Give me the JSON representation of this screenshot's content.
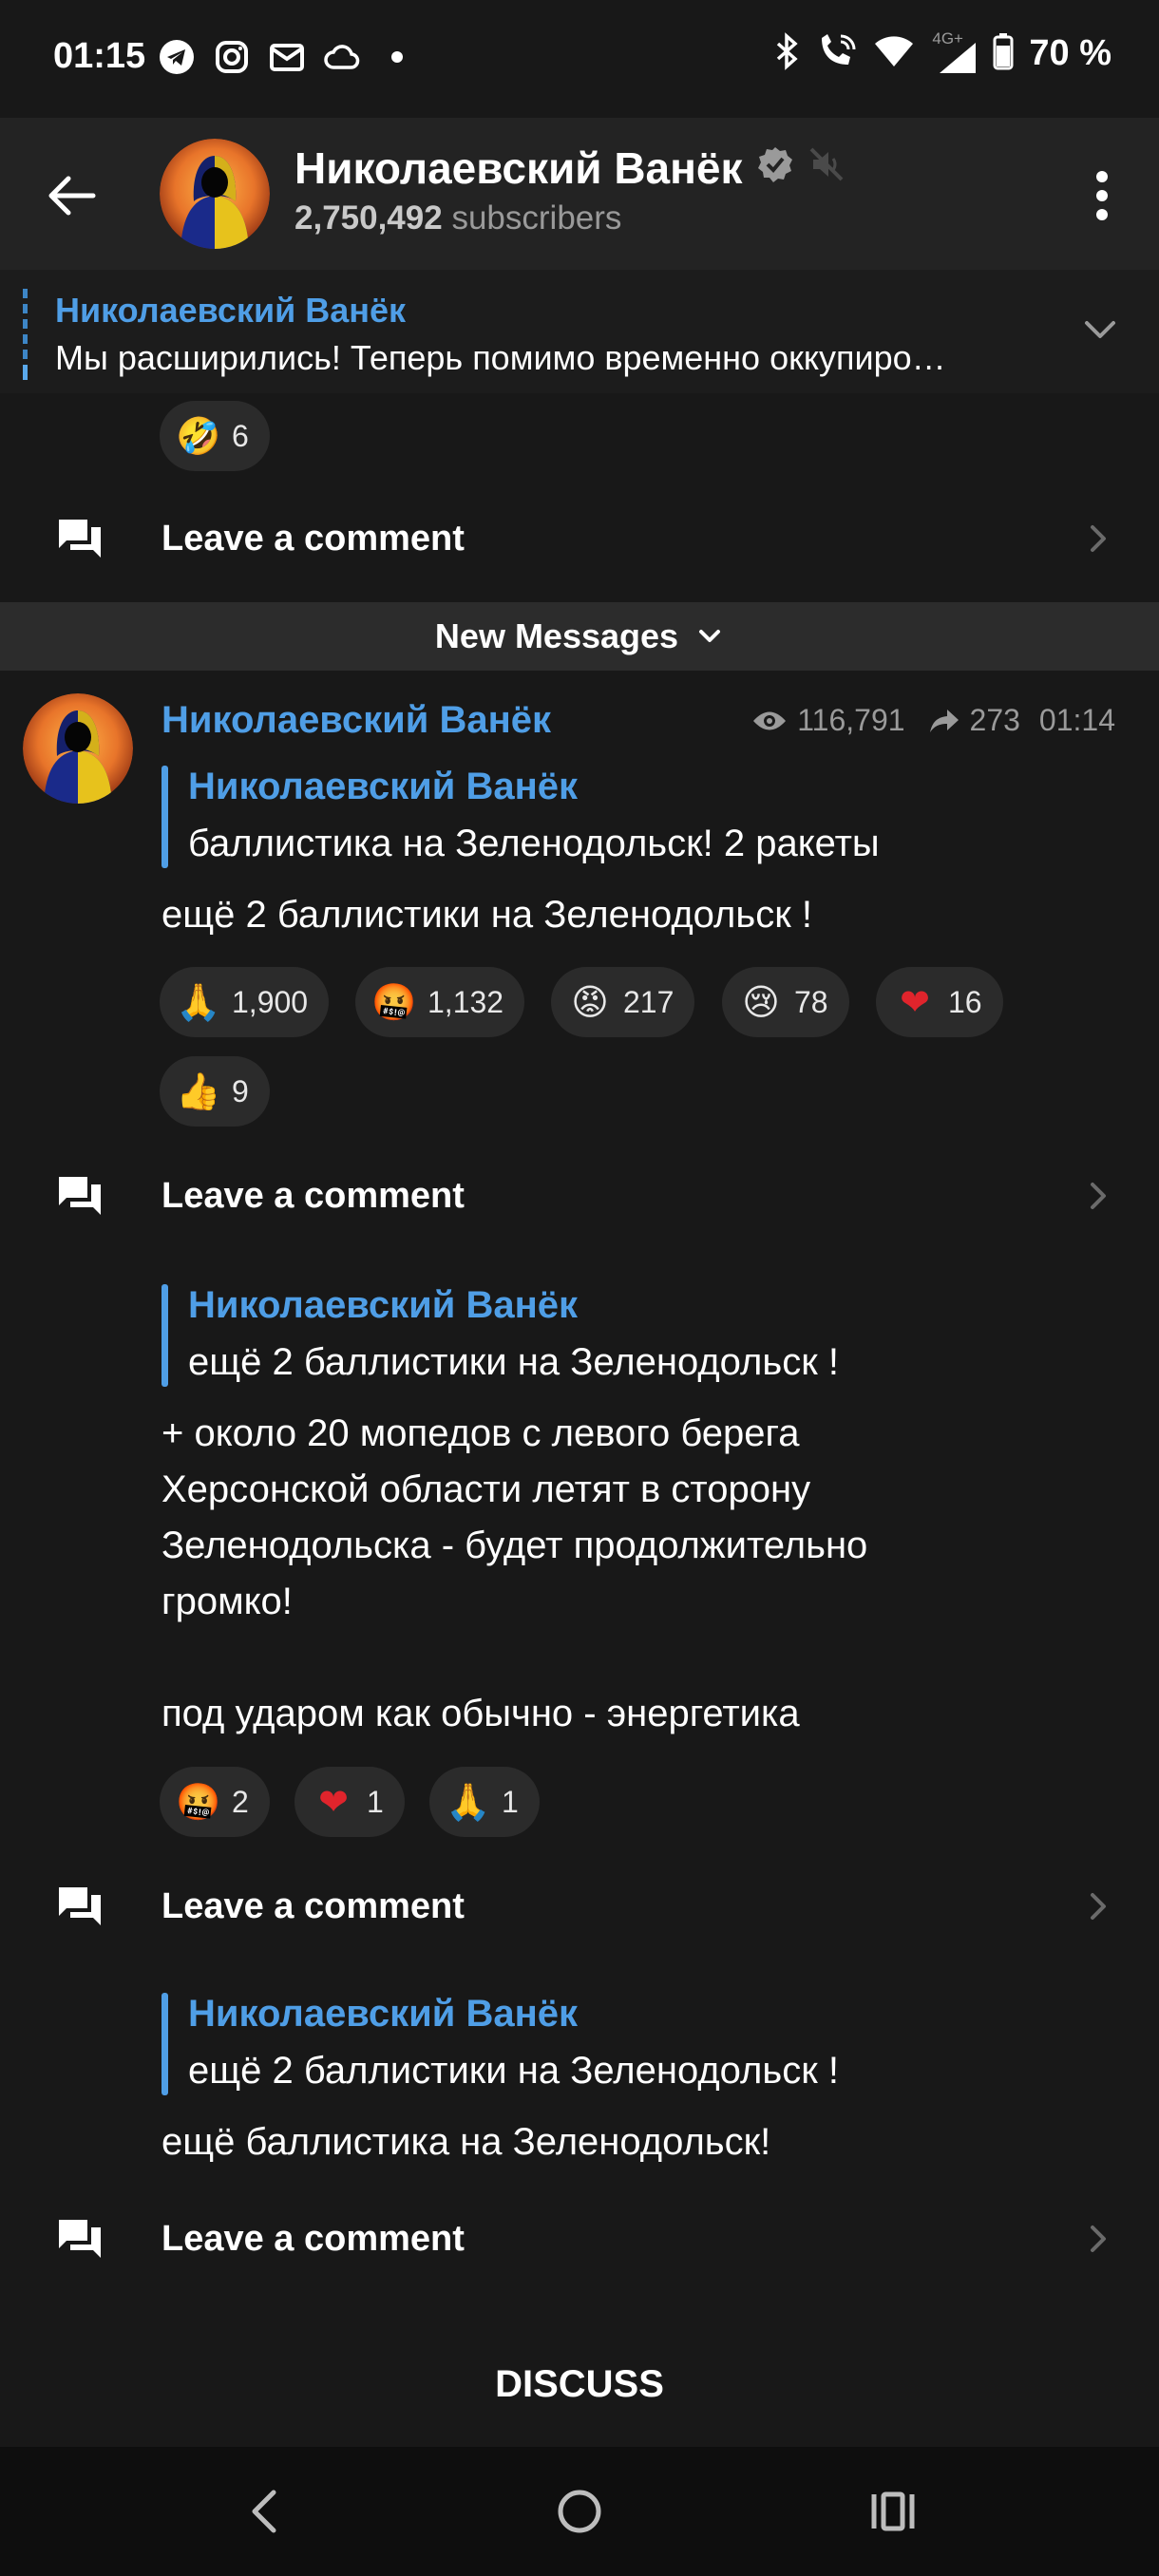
{
  "status_bar": {
    "time": "01:15",
    "battery": "70 %",
    "network": "4G+",
    "icons_left": [
      "telegram-icon",
      "instagram-icon",
      "mail-icon",
      "cloud-icon",
      "dot-icon"
    ],
    "icons_right": [
      "bluetooth-icon",
      "wifi-call-icon",
      "wifi-icon",
      "signal-icon",
      "battery-icon"
    ]
  },
  "header": {
    "title": "Николаевский Ванёк",
    "subscribers_count": "2,750,492",
    "subscribers_label": "subscribers",
    "verified": true,
    "muted": true
  },
  "pinned": {
    "title": "Николаевский Ванёк",
    "text": "Мы расширились!  Теперь помимо временно оккупиро…"
  },
  "top_post": {
    "reactions": [
      {
        "emoji": "🤣",
        "count": "6"
      }
    ],
    "comment_label": "Leave a comment"
  },
  "new_messages": {
    "label": "New Messages"
  },
  "post1": {
    "author": "Николаевский Ванёк",
    "views": "116,791",
    "forwards": "273",
    "time": "01:14",
    "quote_name": "Николаевский Ванёк",
    "quote_text": "баллистика на Зеленодольск! 2 ракеты",
    "text": "ещё 2 баллистики на Зеленодольск !",
    "reactions": [
      {
        "emoji": "🙏",
        "count": "1,900"
      },
      {
        "emoji": "🤬",
        "count": "1,132"
      },
      {
        "emoji": "😡",
        "count": "217"
      },
      {
        "emoji": "😢",
        "count": "78"
      },
      {
        "emoji": "❤",
        "count": "16"
      },
      {
        "emoji": "👍",
        "count": "9"
      }
    ],
    "comment_label": "Leave a comment"
  },
  "post2": {
    "quote_name": "Николаевский Ванёк",
    "quote_text": "ещё 2 баллистики на Зеленодольск !",
    "text": "+ около 20 мопедов с левого берега\nХерсонской области летят в сторону\nЗеленодольска - будет продолжительно\nгромко!\n\nпод ударом как обычно - энергетика",
    "reactions": [
      {
        "emoji": "🤬",
        "count": "2"
      },
      {
        "emoji": "❤",
        "count": "1"
      },
      {
        "emoji": "🙏",
        "count": "1"
      }
    ],
    "comment_label": "Leave a comment"
  },
  "post3": {
    "quote_name": "Николаевский Ванёк",
    "quote_text": "ещё 2 баллистики на Зеленодольск !",
    "text": "ещё баллистика на Зеленодольск!",
    "comment_label": "Leave a comment"
  },
  "discuss_label": "DISCUSS",
  "colors": {
    "accent": "#4f9ee6",
    "background": "#181818",
    "header": "#232323",
    "reaction_bg": "#2b2b2b"
  }
}
